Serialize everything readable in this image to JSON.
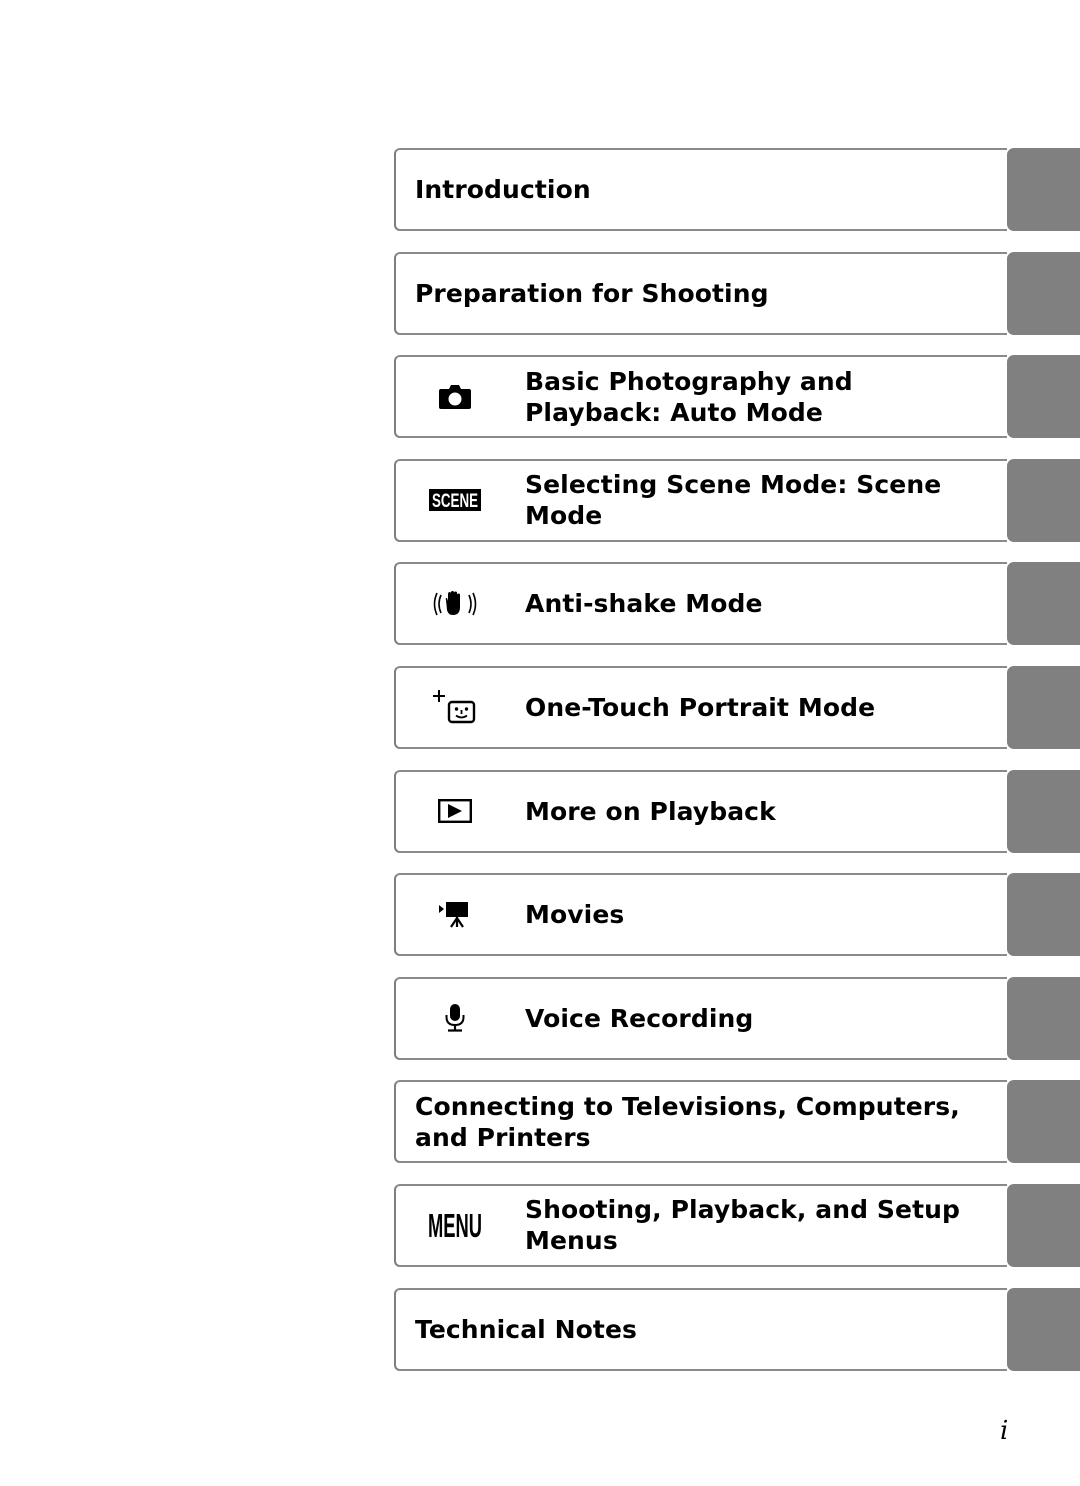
{
  "document": {
    "page_number": "i"
  },
  "toc": {
    "items": [
      {
        "label": "Introduction",
        "icon": null
      },
      {
        "label": "Preparation for Shooting",
        "icon": null
      },
      {
        "label": "Basic Photography and Playback: Auto Mode",
        "icon": "camera-icon"
      },
      {
        "label": "Selecting Scene Mode: Scene Mode",
        "icon": "scene-icon",
        "icon_text": "SCENE"
      },
      {
        "label": "Anti-shake Mode",
        "icon": "anti-shake-hand-icon"
      },
      {
        "label": "One-Touch Portrait Mode",
        "icon": "portrait-face-icon"
      },
      {
        "label": "More on Playback",
        "icon": "playback-icon"
      },
      {
        "label": "Movies",
        "icon": "movie-camera-icon"
      },
      {
        "label": "Voice Recording",
        "icon": "microphone-icon"
      },
      {
        "label": "Connecting to Televisions, Computers, and Printers",
        "icon": null
      },
      {
        "label": "Shooting, Playback, and Setup Menus",
        "icon": "menu-icon",
        "icon_text": "MENU"
      },
      {
        "label": "Technical Notes",
        "icon": null
      }
    ]
  },
  "colors": {
    "tab_gray": "#808080",
    "border_gray": "#7e7e7e",
    "text": "#000000"
  }
}
